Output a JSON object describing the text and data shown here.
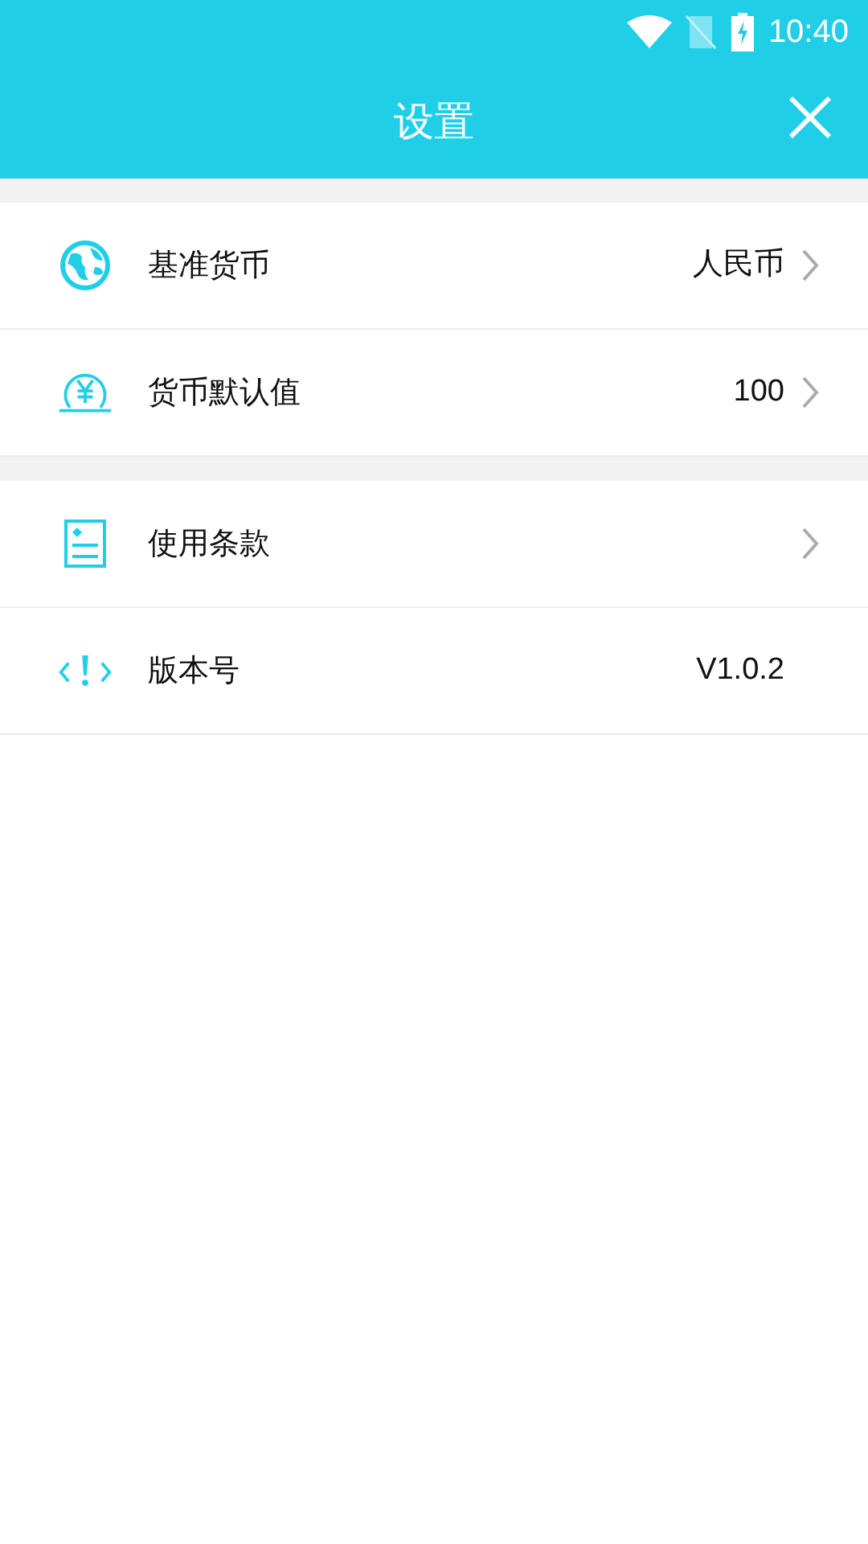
{
  "status_bar": {
    "time": "10:40"
  },
  "header": {
    "title": "设置"
  },
  "sections": [
    {
      "items": [
        {
          "label": "基准货币",
          "value": "人民币",
          "chevron": true
        },
        {
          "label": "货币默认值",
          "value": "100",
          "chevron": true
        }
      ]
    },
    {
      "items": [
        {
          "label": "使用条款",
          "chevron": true
        },
        {
          "label": "版本号",
          "value": "V1.0.2",
          "chevron": false
        }
      ]
    }
  ]
}
